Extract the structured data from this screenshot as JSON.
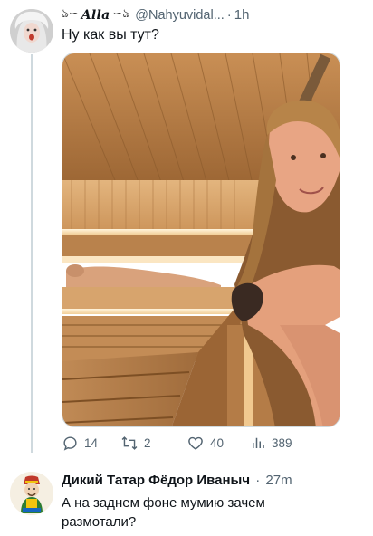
{
  "tweet": {
    "display_name": "Alla",
    "handle": "@Nahyuvidal...",
    "separator": "·",
    "time": "1h",
    "text": "Ну как вы тут?",
    "actions": {
      "replies": "14",
      "retweets": "2",
      "likes": "40",
      "views": "389"
    }
  },
  "reply": {
    "display_name": "Дикий Татар Фёдор Иваныч",
    "separator": "·",
    "time": "27m",
    "text": "А на заднем фоне мумию зачем размотали?"
  }
}
